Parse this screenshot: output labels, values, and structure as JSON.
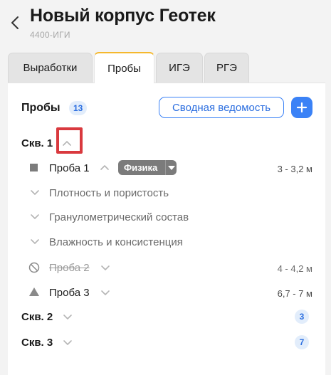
{
  "header": {
    "title": "Новый корпус Геотек",
    "subtitle": "4400-ИГИ"
  },
  "tabs": [
    {
      "label": "Выработки",
      "active": false
    },
    {
      "label": "Пробы",
      "active": true
    },
    {
      "label": "ИГЭ",
      "active": false
    },
    {
      "label": "РГЭ",
      "active": false
    }
  ],
  "panel": {
    "title": "Пробы",
    "count": "13",
    "summary_button": "Сводная ведомость",
    "add_icon": "plus-icon"
  },
  "wells": [
    {
      "label": "Скв. 1",
      "expanded": true,
      "probes": [
        {
          "label": "Проба 1",
          "status_icon": "square-icon",
          "depth": "3 - 3,2 м",
          "tag": "Физика",
          "expanded": true,
          "tests": [
            "Плотность и пористость",
            "Гранулометрический состав",
            "Влажность и консистенция"
          ]
        },
        {
          "label": "Проба 2",
          "status_icon": "prohibited-icon",
          "depth": "4 - 4,2 м",
          "struck": true
        },
        {
          "label": "Проба 3",
          "status_icon": "triangle-icon",
          "depth": "6,7 - 7 м"
        }
      ]
    },
    {
      "label": "Скв. 2",
      "expanded": false,
      "count": "3"
    },
    {
      "label": "Скв. 3",
      "expanded": false,
      "count": "7"
    }
  ],
  "colors": {
    "accent": "#3b82f6",
    "tab_active_border": "#f5b82e",
    "highlight": "#d9393e",
    "tag_bg": "#7b7b7b",
    "badge_bg": "#e2edfb"
  }
}
